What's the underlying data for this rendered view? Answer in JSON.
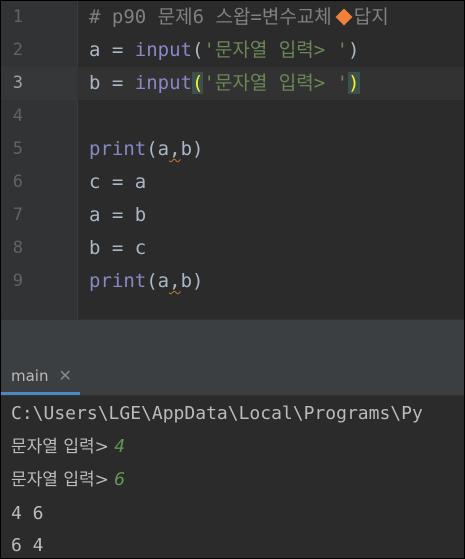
{
  "editor": {
    "line_numbers": [
      "1",
      "2",
      "3",
      "4",
      "5",
      "6",
      "7",
      "8",
      "9"
    ],
    "current_line": "3",
    "lines": {
      "l1_comment": "# p90 문제6 스왑=변수교체",
      "l1_todo": "답지",
      "l2_var": "a",
      "l2_eq": " = ",
      "l2_fn": "input",
      "l2_open": "(",
      "l2_str": "'문자열 입력> '",
      "l2_close": ")",
      "l3_var": "b",
      "l3_eq": " = ",
      "l3_fn": "input",
      "l3_open": "(",
      "l3_str": "'문자열 입력> '",
      "l3_close": ")",
      "l5_fn": "print",
      "l5_open": "(",
      "l5_a": "a",
      "l5_comma": ",",
      "l5_b": "b",
      "l5_close": ")",
      "l6": "c = a",
      "l7": "a = b",
      "l8": "b = c",
      "l9_fn": "print",
      "l9_open": "(",
      "l9_a": "a",
      "l9_comma": ",",
      "l9_b": "b",
      "l9_close": ")"
    }
  },
  "run_panel": {
    "tab_label": "main",
    "close_glyph": "✕",
    "output": {
      "cmd": "C:\\Users\\LGE\\AppData\\Local\\Programs\\Py",
      "prompt1": "문자열 입력> ",
      "input1": "4",
      "prompt2": "문자열 입력> ",
      "input2": "6",
      "result1": "4 6",
      "result2": "6 4"
    }
  },
  "colors": {
    "background": "#2b2b2b",
    "gutter": "#313335",
    "keyword_fn": "#8888c6",
    "string": "#6a8759",
    "comment": "#808080",
    "identifier": "#a9b7c6",
    "todo_marker": "#f0813b",
    "user_input": "#629755"
  },
  "icons": {
    "todo_marker": "diamond-icon",
    "close": "close-icon"
  }
}
